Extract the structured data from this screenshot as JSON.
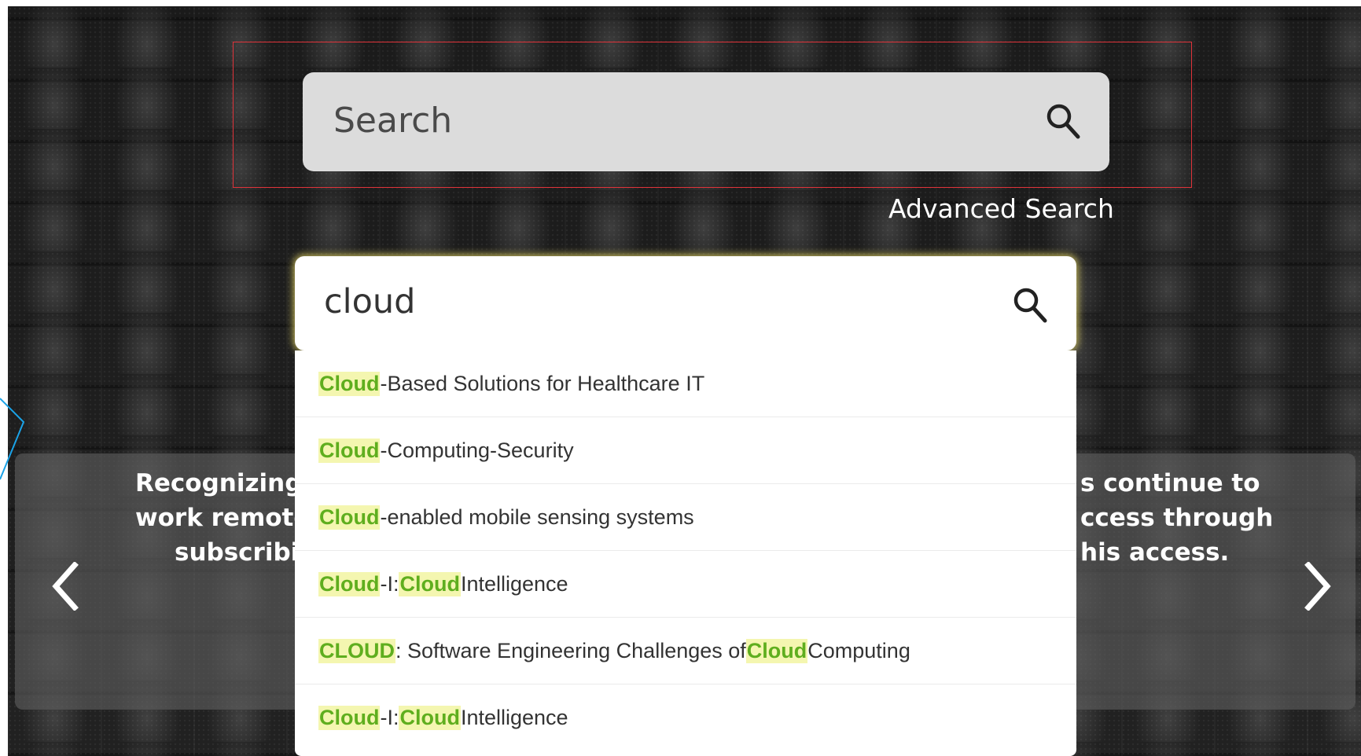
{
  "top_search": {
    "placeholder": "Search"
  },
  "advanced_search": {
    "label": "Advanced Search"
  },
  "main_search": {
    "value": "cloud"
  },
  "suggestions": [
    {
      "parts": [
        {
          "text": "Cloud",
          "hl": true
        },
        {
          "text": "-Based Solutions for Healthcare IT",
          "hl": false
        }
      ]
    },
    {
      "parts": [
        {
          "text": "Cloud",
          "hl": true
        },
        {
          "text": "-Computing-Security",
          "hl": false
        }
      ]
    },
    {
      "parts": [
        {
          "text": "Cloud",
          "hl": true
        },
        {
          "text": "-enabled mobile sensing systems",
          "hl": false
        }
      ]
    },
    {
      "parts": [
        {
          "text": "Cloud",
          "hl": true
        },
        {
          "text": "-I: ",
          "hl": false
        },
        {
          "text": "Cloud",
          "hl": true
        },
        {
          "text": " Intelligence",
          "hl": false
        }
      ]
    },
    {
      "parts": [
        {
          "text": "CLOUD",
          "hl": true
        },
        {
          "text": ": Software Engineering Challenges of ",
          "hl": false
        },
        {
          "text": "Cloud",
          "hl": true
        },
        {
          "text": " Computing",
          "hl": false
        }
      ]
    },
    {
      "parts": [
        {
          "text": "Cloud",
          "hl": true
        },
        {
          "text": "-I: ",
          "hl": false
        },
        {
          "text": "Cloud",
          "hl": true
        },
        {
          "text": " Intelligence",
          "hl": false
        }
      ]
    }
  ],
  "banner": {
    "left_lines": [
      "Recognizing t",
      "work remotel",
      "subscribin"
    ],
    "right_lines": [
      "s continue to",
      "ccess through",
      "his access."
    ]
  },
  "icons": {
    "search": "search-icon",
    "prev": "chevron-left-icon",
    "next": "chevron-right-icon"
  },
  "colors": {
    "annotation_border": "#e0333a",
    "highlight_text": "#5fae1e",
    "highlight_bg": "#f4f6b0",
    "focus_glow": "#e1d264"
  }
}
